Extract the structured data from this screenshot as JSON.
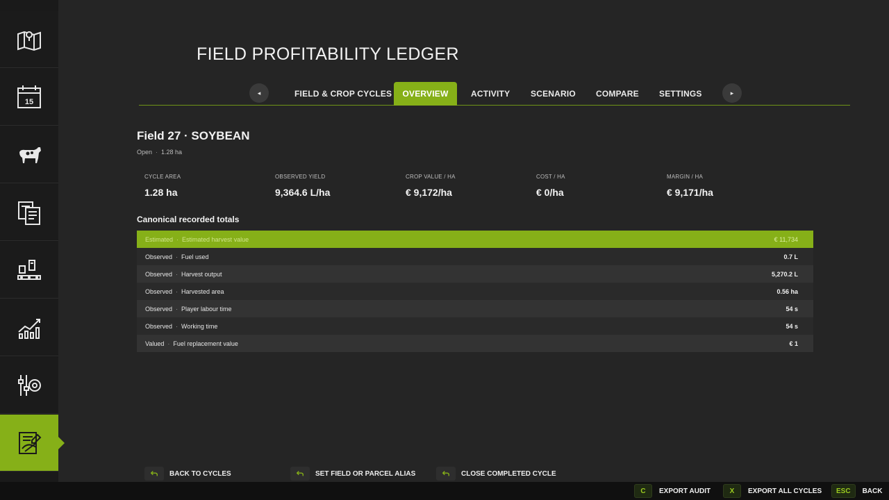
{
  "sidebar": {
    "items": [
      {
        "icon": "map-pin-icon"
      },
      {
        "icon": "calendar-icon",
        "day": "15"
      },
      {
        "icon": "cow-icon"
      },
      {
        "icon": "documents-icon"
      },
      {
        "icon": "production-icon"
      },
      {
        "icon": "statistics-icon"
      },
      {
        "icon": "settings-sliders-icon"
      },
      {
        "icon": "ledger-icon"
      }
    ],
    "active_index": 7,
    "accent": "#86b018"
  },
  "header": {
    "title": "FIELD PROFITABILITY LEDGER"
  },
  "tabs": {
    "items": [
      {
        "label": "FIELD & CROP CYCLES"
      },
      {
        "label": "OVERVIEW"
      },
      {
        "label": "ACTIVITY"
      },
      {
        "label": "SCENARIO"
      },
      {
        "label": "COMPARE"
      },
      {
        "label": "SETTINGS"
      }
    ],
    "active": "OVERVIEW",
    "prev_glyph": "◂",
    "next_glyph": "▸"
  },
  "field": {
    "title": "Field 27  ·  SOYBEAN",
    "status": "Open",
    "area": "1.28 ha"
  },
  "stats": [
    {
      "label": "CYCLE AREA",
      "value": "1.28 ha"
    },
    {
      "label": "OBSERVED YIELD",
      "value": "9,364.6 L/ha"
    },
    {
      "label": "CROP VALUE / HA",
      "value": "€ 9,172/ha"
    },
    {
      "label": "COST / HA",
      "value": "€ 0/ha"
    },
    {
      "label": "MARGIN / HA",
      "value": "€ 9,171/ha"
    }
  ],
  "totals": {
    "title": "Canonical recorded totals",
    "rows": [
      {
        "kind": "Estimated",
        "name": "Estimated harvest value",
        "value": "€ 11,734"
      },
      {
        "kind": "Observed",
        "name": "Fuel used",
        "value": "0.7 L"
      },
      {
        "kind": "Observed",
        "name": "Harvest output",
        "value": "5,270.2 L"
      },
      {
        "kind": "Observed",
        "name": "Harvested area",
        "value": "0.56 ha"
      },
      {
        "kind": "Observed",
        "name": "Player labour time",
        "value": "54 s"
      },
      {
        "kind": "Observed",
        "name": "Working time",
        "value": "54 s"
      },
      {
        "kind": "Valued",
        "name": "Fuel replacement value",
        "value": "€ 1"
      }
    ],
    "highlight_index": 0
  },
  "actions": [
    {
      "label": "BACK TO CYCLES",
      "icon": "gamepad-button-icon"
    },
    {
      "label": "SET FIELD OR PARCEL ALIAS",
      "icon": "gamepad-button-icon"
    },
    {
      "label": "CLOSE COMPLETED CYCLE",
      "icon": "gamepad-button-icon"
    }
  ],
  "bottom_keys": [
    {
      "key": "C",
      "label": "EXPORT AUDIT"
    },
    {
      "key": "X",
      "label": "EXPORT ALL CYCLES"
    },
    {
      "key": "ESC",
      "label": "BACK"
    }
  ]
}
